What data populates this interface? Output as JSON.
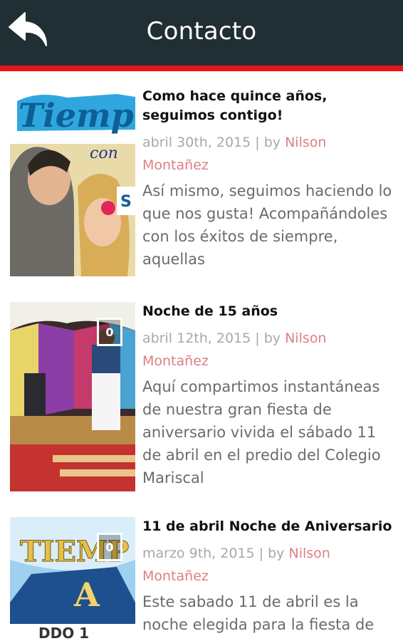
{
  "header": {
    "title": "Contacto",
    "back_icon": "back-arrow-icon",
    "background": "#1f2f33",
    "accent_line": "#e8141b"
  },
  "posts": [
    {
      "title": "Como hace quince años, seguimos contigo!",
      "date": "abril 30th, 2015",
      "separator": "|",
      "by": "by",
      "author": "Nilson Montañez",
      "excerpt": "Así mismo, seguimos haciendo lo que nos gusta! Acompañándoles con los éxitos de siempre, aquellas"
    },
    {
      "title": "Noche de 15 años",
      "date": "abril 12th, 2015",
      "separator": "|",
      "by": "by",
      "author": "Nilson Montañez",
      "excerpt": "Aquí compartimos instantáneas de nuestra gran fiesta de aniversario vivida el sábado 11 de abril en el predio del Colegio Mariscal",
      "badge": "0"
    },
    {
      "title": "11 de abril Noche de Aniversario",
      "date": "marzo 9th, 2015",
      "separator": "|",
      "by": "by",
      "author": "Nilson Montañez",
      "excerpt": "Este sabado 11 de abril es la noche elegida para la fiesta de",
      "badge": "0"
    }
  ],
  "colors": {
    "title_text": "#111111",
    "meta_text": "#a8a8a8",
    "author_link": "#e07e83",
    "excerpt_text": "#6b6b6b"
  }
}
